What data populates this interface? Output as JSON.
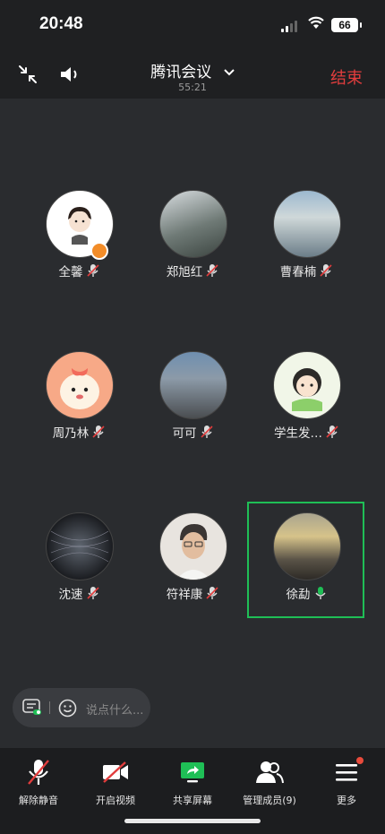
{
  "status_bar": {
    "time": "20:48",
    "battery": "66"
  },
  "header": {
    "title": "腾讯会议",
    "duration": "55:21",
    "end_label": "结束"
  },
  "participants": [
    {
      "name": "全馨"
    },
    {
      "name": "郑旭红"
    },
    {
      "name": "曹春楠"
    },
    {
      "name": "周乃林"
    },
    {
      "name": "可可"
    },
    {
      "name": "学生发…"
    },
    {
      "name": "沈速"
    },
    {
      "name": "符祥康"
    },
    {
      "name": "徐勐"
    }
  ],
  "chat": {
    "placeholder": "说点什么..."
  },
  "toolbar": {
    "unmute_label": "解除静音",
    "video_label": "开启视频",
    "share_label": "共享屏幕",
    "members_label": "管理成员(9)",
    "more_label": "更多"
  },
  "colors": {
    "accent_green": "#1fbf56",
    "end_red": "#e23d3d",
    "badge_red": "#e84b3c"
  }
}
